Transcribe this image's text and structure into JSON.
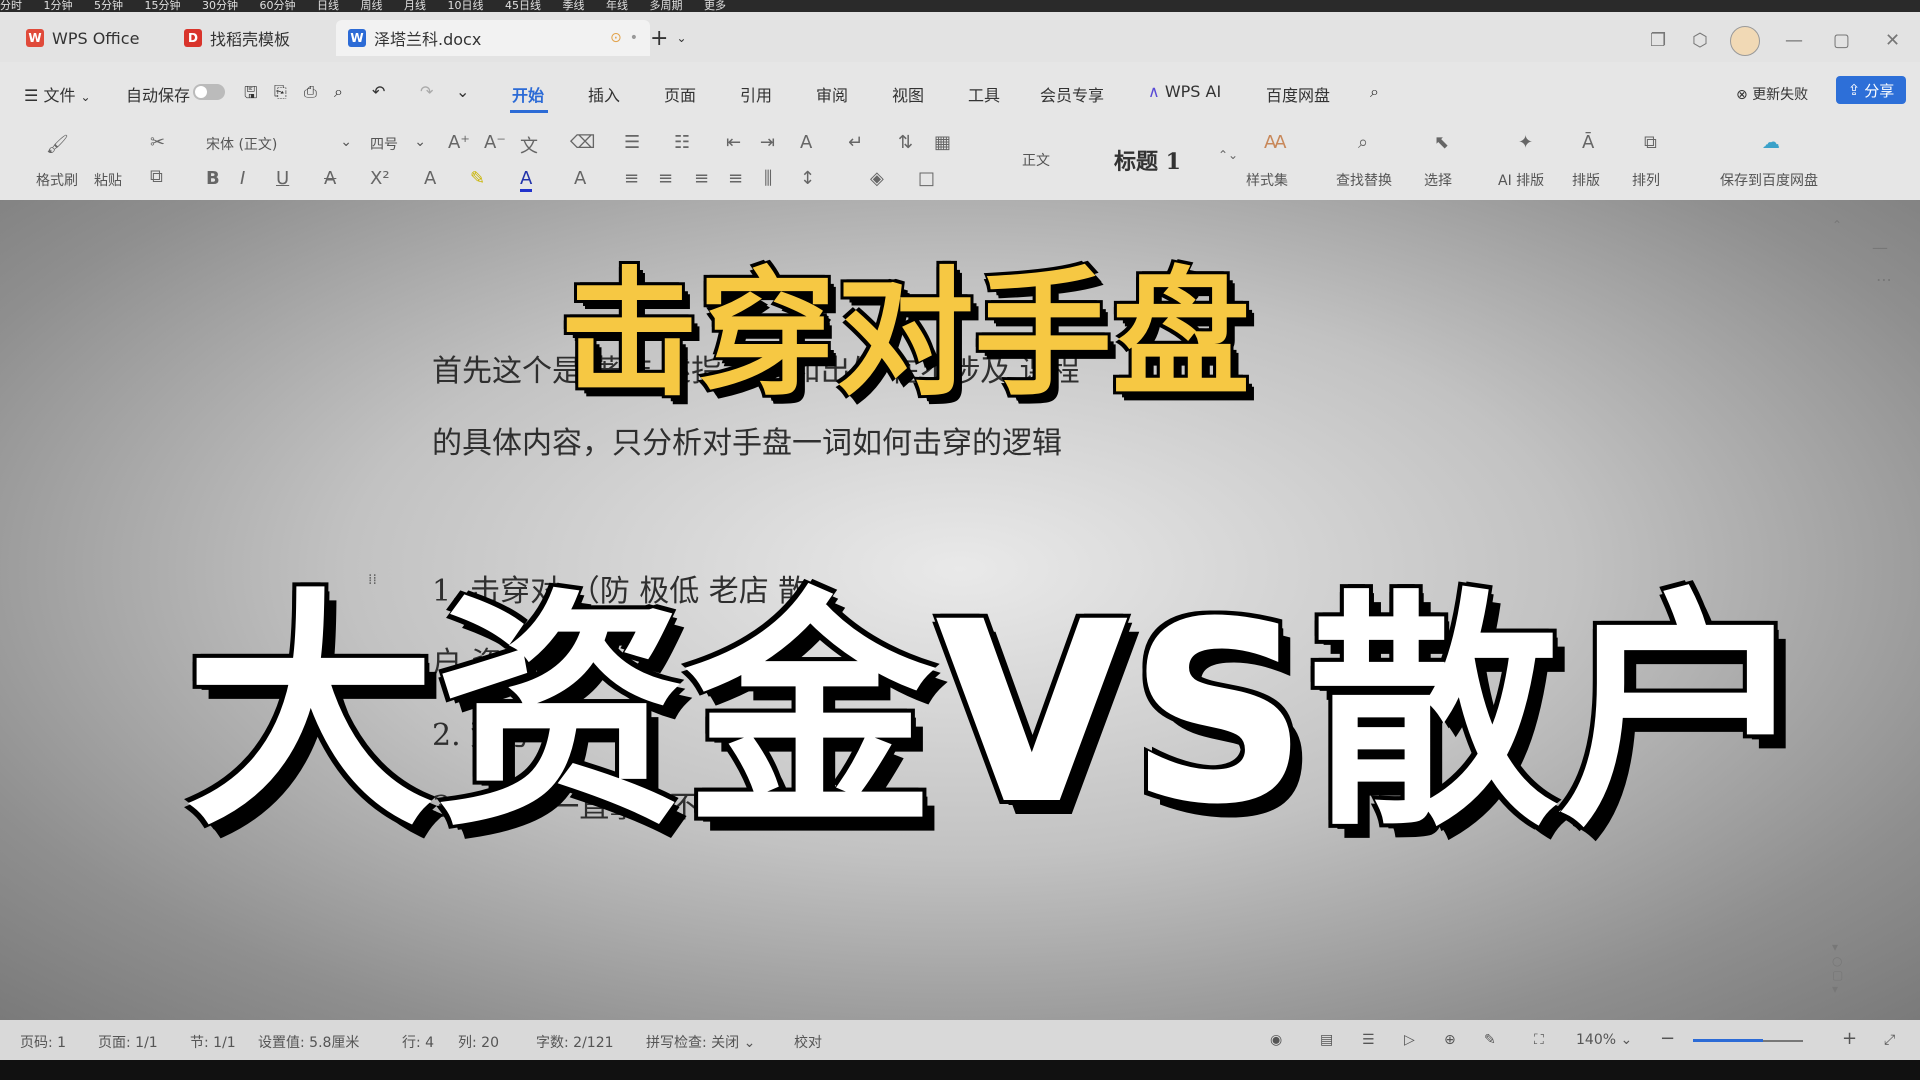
{
  "tabs": {
    "app": "WPS Office",
    "template": "找稻壳模板",
    "document": "泽塔兰科.docx",
    "new_tab": "+"
  },
  "menu": {
    "file": "文件",
    "autosave": "自动保存",
    "items": [
      "开始",
      "插入",
      "页面",
      "引用",
      "审阅",
      "视图",
      "工具",
      "会员专享",
      "WPS AI",
      "百度网盘"
    ],
    "update_failed": "更新失败",
    "share": "分享"
  },
  "ribbon": {
    "format_painter": "格式刷",
    "paste": "粘贴",
    "font_name": "宋体 (正文)",
    "font_size": "四号",
    "style_body": "正文",
    "style_heading": "标题 1",
    "style_set": "样式集",
    "find_replace": "查找替换",
    "select": "选择",
    "ai_layout": "AI 排版",
    "layout": "排版",
    "arrange": "排列",
    "save_to_baidu": "保存到百度网盘"
  },
  "document": {
    "line1": "首先这个是 著作 述指 作者和出处 在不涉及 课程",
    "line2": "的具体内容，只分析对手盘一词如何击穿的逻辑",
    "line3": "1.  击穿对 （防 极低 老店 散",
    "line4": "户 资",
    "line5": "2. 势与 ？",
    "line6": "3. 的 与 一直拿具不动吗？"
  },
  "overlay": {
    "title_top": "击穿对手盘",
    "title_main": "大资金VS散户"
  },
  "status": {
    "page_no": "页码: 1",
    "pages": "页面: 1/1",
    "section": "节: 1/1",
    "setting": "设置值: 5.8厘米",
    "row": "行: 4",
    "col": "列: 20",
    "word_count": "字数: 2/121",
    "spell_check": "拼写检查: 关闭",
    "proofread": "校对",
    "zoom": "140%"
  },
  "ticker": [
    "分时",
    "1分钟",
    "5分钟",
    "15分钟",
    "30分钟",
    "60分钟",
    "日线",
    "周线",
    "月线",
    "10日线",
    "45日线",
    "季线",
    "年线",
    "多周期",
    "更多"
  ],
  "colors": {
    "accent": "#2c6bd6",
    "title_top": "#f6c843",
    "title_main": "#ffffff"
  }
}
